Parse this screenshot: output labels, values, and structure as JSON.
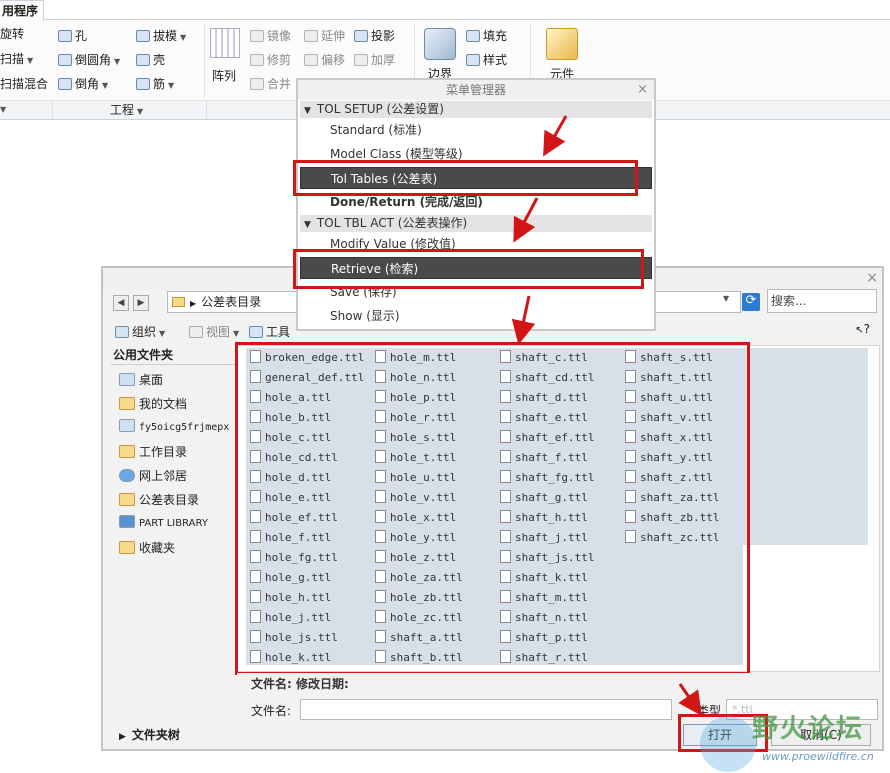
{
  "ribbon": {
    "app_tab": "用程序",
    "col1": [
      "旋转",
      "扫描",
      "扫描混合"
    ],
    "col2": [
      "孔",
      "倒圆角",
      "倒角"
    ],
    "col3": [
      "拔模",
      "壳",
      "筋"
    ],
    "array_label": "阵列",
    "col4": [
      "镜像",
      "修剪",
      "合并"
    ],
    "col5": [
      "延伸",
      "偏移"
    ],
    "col6": [
      "投影",
      "加厚"
    ],
    "surface_label": "边界",
    "col7": [
      "填充",
      "样式"
    ],
    "element_label": "元件",
    "group_engineering": "工程"
  },
  "menu_manager": {
    "title": "菜单管理器",
    "section1_header": "TOL SETUP (公差设置)",
    "section1_items": [
      "Standard (标准)",
      "Model Class (模型等级)",
      "Tol Tables (公差表)",
      "Done/Return (完成/返回)"
    ],
    "section2_header": "TOL TBL ACT (公差表操作)",
    "section2_items": [
      "Modify Value (修改值)",
      "Retrieve (检索)",
      "Save (保存)",
      "Show (显示)"
    ]
  },
  "dialog": {
    "address": "公差表目录",
    "search_placeholder": "搜索...",
    "toolbar": {
      "organize": "组织",
      "views": "视图",
      "tools": "工具"
    },
    "help": "?",
    "sidebar_header": "公用文件夹",
    "sidebar_items": [
      "桌面",
      "我的文档",
      "fy5oicg5frjmepx",
      "工作目录",
      "网上邻居",
      "公差表目录",
      "PART LIBRARY",
      "收藏夹"
    ],
    "files_col1": [
      "broken_edge.ttl",
      "general_def.ttl",
      "hole_a.ttl",
      "hole_b.ttl",
      "hole_c.ttl",
      "hole_cd.ttl",
      "hole_d.ttl",
      "hole_e.ttl",
      "hole_ef.ttl",
      "hole_f.ttl",
      "hole_fg.ttl",
      "hole_g.ttl",
      "hole_h.ttl",
      "hole_j.ttl",
      "hole_js.ttl",
      "hole_k.ttl"
    ],
    "files_col2": [
      "hole_m.ttl",
      "hole_n.ttl",
      "hole_p.ttl",
      "hole_r.ttl",
      "hole_s.ttl",
      "hole_t.ttl",
      "hole_u.ttl",
      "hole_v.ttl",
      "hole_x.ttl",
      "hole_y.ttl",
      "hole_z.ttl",
      "hole_za.ttl",
      "hole_zb.ttl",
      "hole_zc.ttl",
      "shaft_a.ttl",
      "shaft_b.ttl"
    ],
    "files_col3": [
      "shaft_c.ttl",
      "shaft_cd.ttl",
      "shaft_d.ttl",
      "shaft_e.ttl",
      "shaft_ef.ttl",
      "shaft_f.ttl",
      "shaft_fg.ttl",
      "shaft_g.ttl",
      "shaft_h.ttl",
      "shaft_j.ttl",
      "shaft_js.ttl",
      "shaft_k.ttl",
      "shaft_m.ttl",
      "shaft_n.ttl",
      "shaft_p.ttl",
      "shaft_r.ttl"
    ],
    "files_col4": [
      "shaft_s.ttl",
      "shaft_t.ttl",
      "shaft_u.ttl",
      "shaft_v.ttl",
      "shaft_x.ttl",
      "shaft_y.ttl",
      "shaft_z.ttl",
      "shaft_za.ttl",
      "shaft_zb.ttl",
      "shaft_zc.ttl"
    ],
    "detail_header": "文件名:   修改日期:",
    "filename_label": "文件名:",
    "type_label": "类型",
    "type_value": "*.ttl",
    "folder_tree": "文件夹树",
    "open_button": "打开",
    "cancel_button": "取消(C)"
  },
  "watermark": {
    "text": "野火论坛",
    "url": "www.proewildfire.cn"
  },
  "colors": {
    "highlight_red": "#d21515",
    "selected_item": "#4a4a4a",
    "list_bg": "#d7e0e9"
  }
}
